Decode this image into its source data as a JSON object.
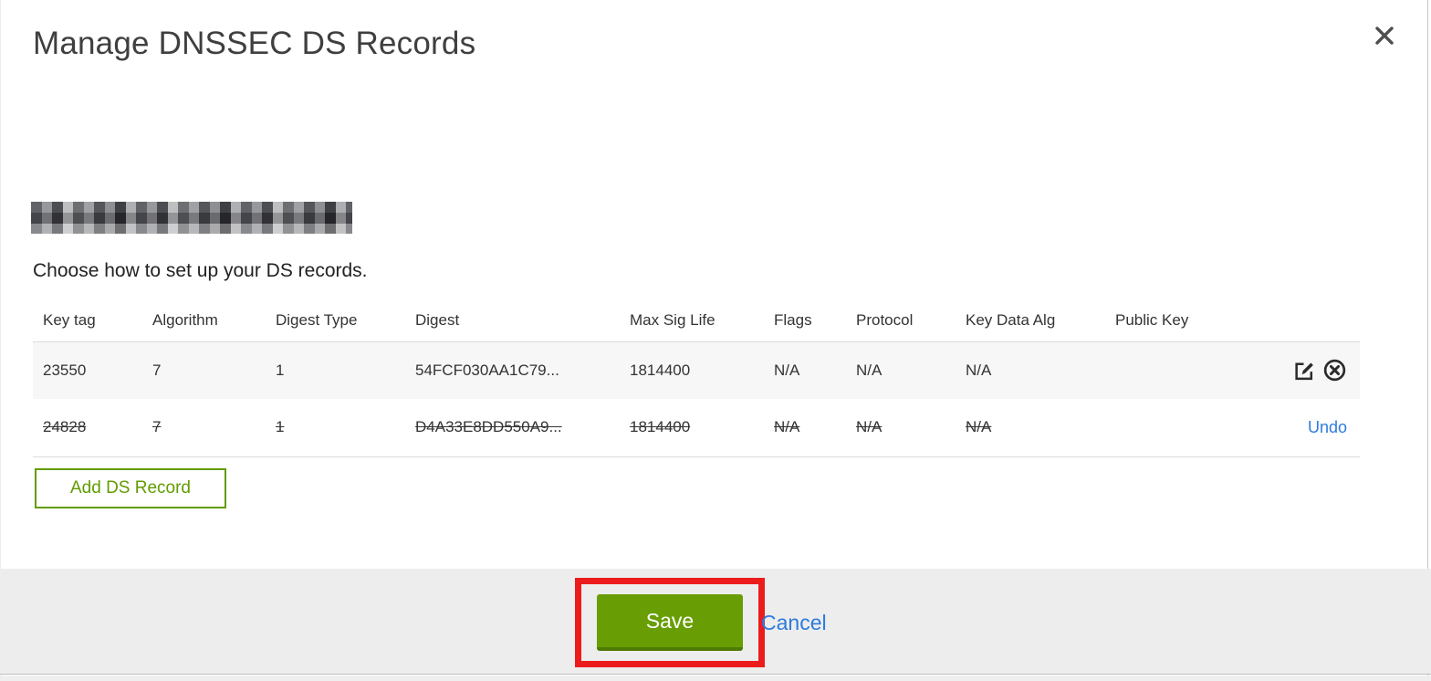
{
  "dialog": {
    "title": "Manage DNSSEC DS Records",
    "subtitle": "Choose how to set up your DS records.",
    "domain": {
      "redacted": true
    },
    "table": {
      "headers": [
        "Key tag",
        "Algorithm",
        "Digest Type",
        "Digest",
        "Max Sig Life",
        "Flags",
        "Protocol",
        "Key Data Alg",
        "Public Key"
      ],
      "rows": [
        {
          "key_tag": "23550",
          "algorithm": "7",
          "digest_type": "1",
          "digest": "54FCF030AA1C79...",
          "max_sig_life": "1814400",
          "flags": "N/A",
          "protocol": "N/A",
          "key_data_alg": "N/A",
          "public_key": "",
          "status": "active"
        },
        {
          "key_tag": "24828",
          "algorithm": "7",
          "digest_type": "1",
          "digest": "D4A33E8DD550A9...",
          "max_sig_life": "1814400",
          "flags": "N/A",
          "protocol": "N/A",
          "key_data_alg": "N/A",
          "public_key": "",
          "status": "marked-for-deletion",
          "undo_label": "Undo"
        }
      ]
    },
    "add_ds_record_label": "Add DS Record",
    "footer": {
      "save_label": "Save",
      "cancel_label": "Cancel"
    },
    "icons": {
      "close": "x-mark",
      "edit": "pencil-on-square",
      "delete": "x-in-circle"
    }
  },
  "colors": {
    "save_green": "#689e03",
    "add_button_green": "#619c00",
    "link_blue": "#2c7bdf",
    "annotation_red": "#ec1c1d",
    "active_row_gray": "#f7f7f7",
    "footer_gray": "#ededed"
  }
}
